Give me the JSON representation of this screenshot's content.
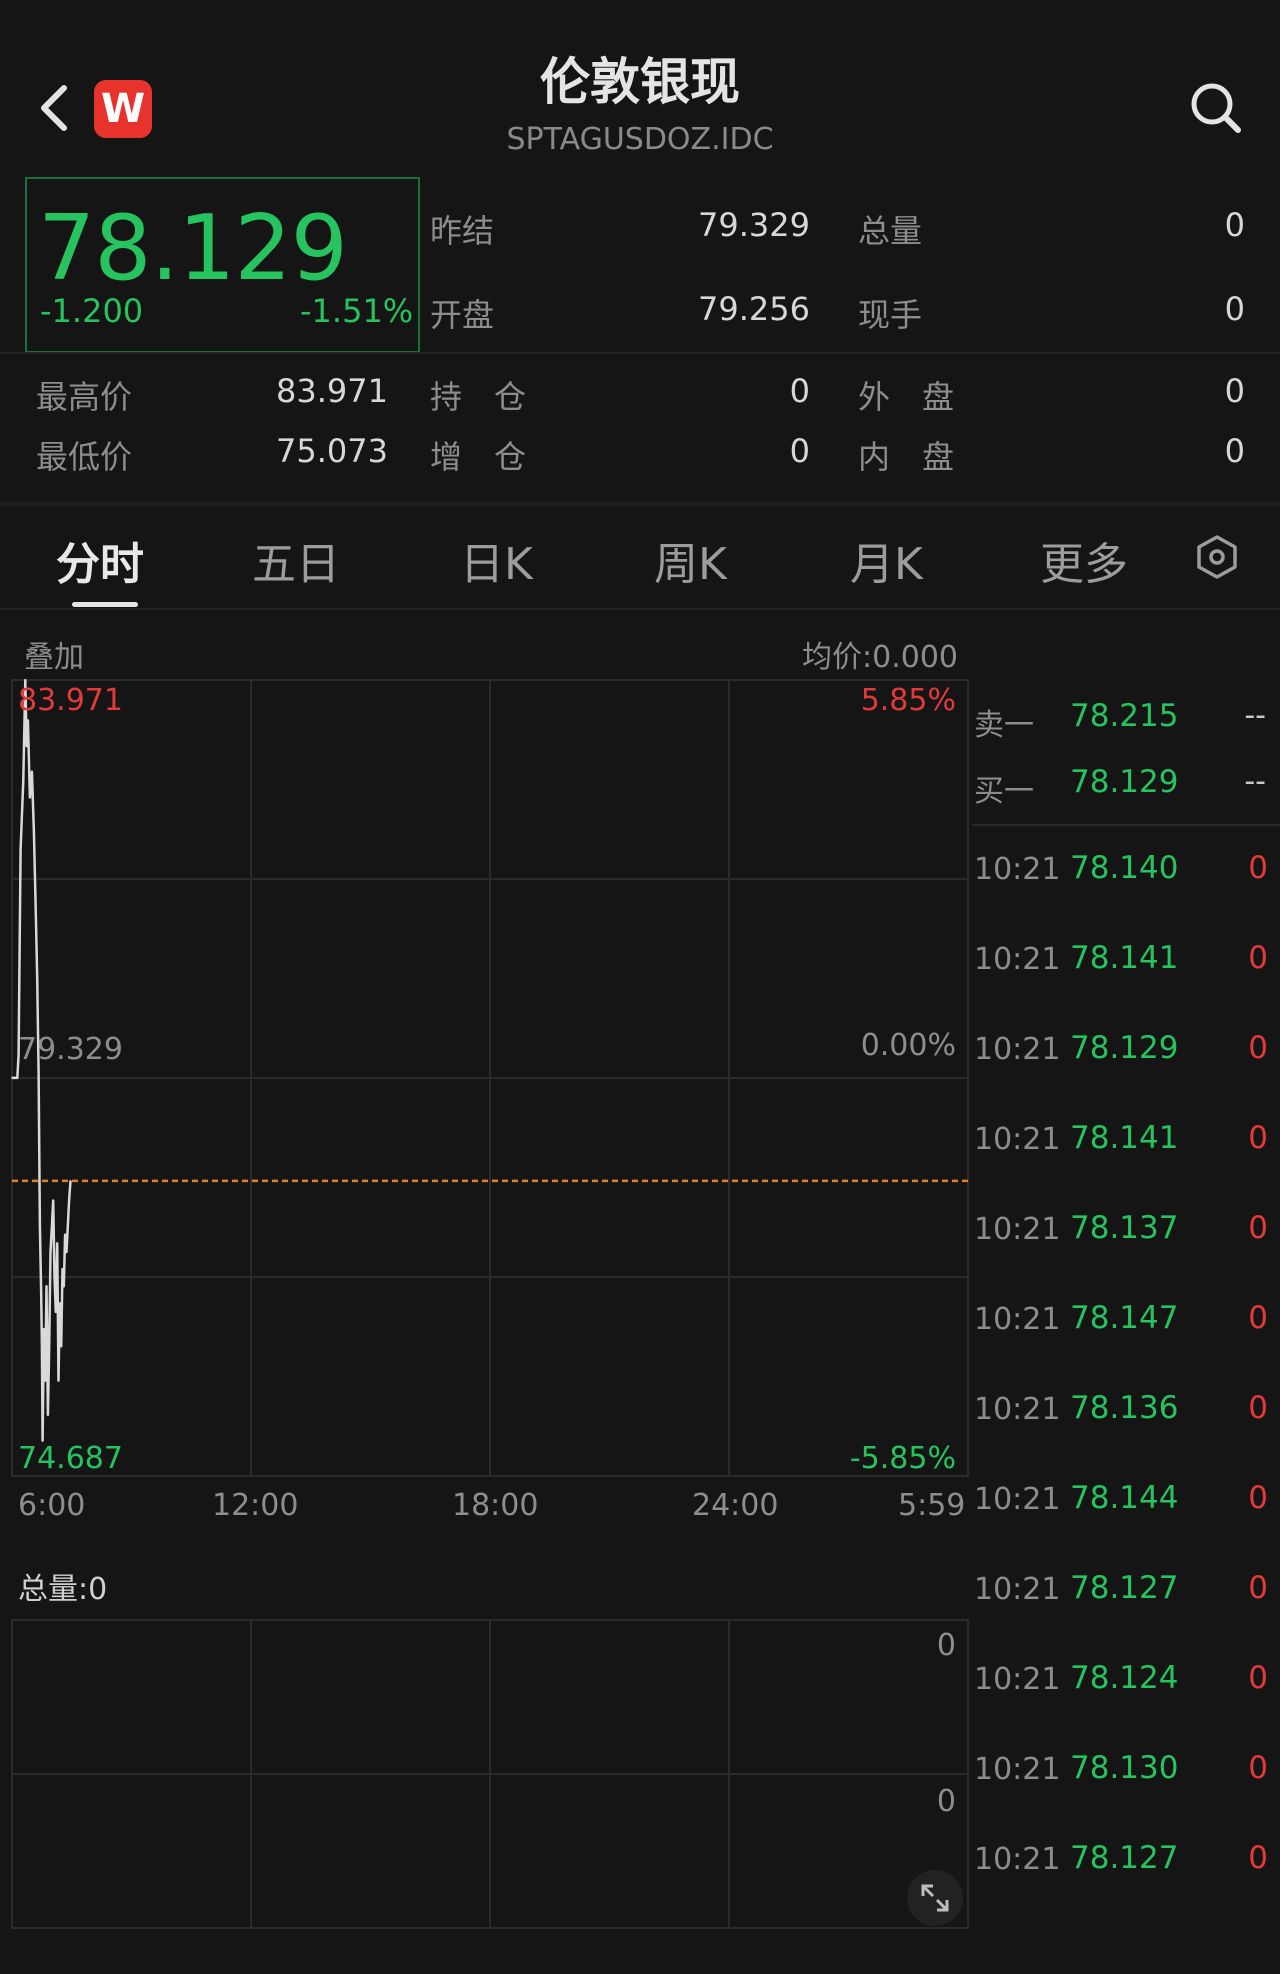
{
  "header": {
    "title": "伦敦银现",
    "code": "SPTAGUSDOZ.IDC",
    "logo_letter": "W"
  },
  "quote": {
    "price": "78.129",
    "change": "-1.200",
    "change_pct": "-1.51%"
  },
  "stats": {
    "prev_settle_label": "昨结",
    "prev_settle": "79.329",
    "total_vol_label": "总量",
    "total_vol": "0",
    "open_label": "开盘",
    "open": "79.256",
    "cur_hand_label": "现手",
    "cur_hand": "0",
    "high_label": "最高价",
    "high": "83.971",
    "pos_label": "持　仓",
    "pos": "0",
    "outer_label": "外　盘",
    "outer": "0",
    "low_label": "最低价",
    "low": "75.073",
    "pos_add_label": "增　仓",
    "pos_add": "0",
    "inner_label": "内　盘",
    "inner": "0"
  },
  "tabs": [
    "分时",
    "五日",
    "日K",
    "周K",
    "月K",
    "更多"
  ],
  "chart": {
    "overlay_label": "叠加",
    "avg_price": "均价:0.000",
    "y_top": "83.971",
    "y_mid": "79.329",
    "y_bottom": "74.687",
    "pct_top": "5.85%",
    "pct_mid": "0.00%",
    "pct_bottom": "-5.85%",
    "x_labels": [
      "6:00",
      "12:00",
      "18:00",
      "24:00",
      "5:59"
    ],
    "volume_label": "总量:0",
    "vol_axis_top": "0",
    "vol_axis_mid": "0",
    "colors": {
      "line": "#d9d9d9",
      "avg_line": "#e0812b",
      "up": "#e23a3a",
      "down": "#27c35f"
    }
  },
  "chart_data": {
    "type": "line",
    "title": "",
    "xlabel": "",
    "ylabel": "",
    "x_ticks": [
      "6:00",
      "12:00",
      "18:00",
      "24:00",
      "5:59"
    ],
    "ylim": [
      74.687,
      83.971
    ],
    "reference_price": 79.329,
    "current_price_line": 78.129,
    "grid": true,
    "series": [
      {
        "name": "",
        "x_minutes_from_start": [
          0,
          7,
          8,
          10,
          13,
          17,
          20,
          22,
          24,
          27,
          30,
          33,
          36,
          38,
          40,
          42,
          44,
          45,
          46,
          48,
          50,
          52,
          54,
          56,
          58,
          60,
          62,
          64,
          66,
          68,
          70,
          72,
          74,
          76,
          78,
          80,
          82,
          84,
          86,
          88
        ],
        "values": [
          79.33,
          79.33,
          79.33,
          79.6,
          82.0,
          82.8,
          83.97,
          83.2,
          83.5,
          82.6,
          82.9,
          82.2,
          81.2,
          80.5,
          79.4,
          77.6,
          76.8,
          76.2,
          75.1,
          76.4,
          75.8,
          76.9,
          75.4,
          76.2,
          77.3,
          77.6,
          77.9,
          77.0,
          76.6,
          77.4,
          75.8,
          76.7,
          76.2,
          77.1,
          76.9,
          77.5,
          77.3,
          77.6,
          77.9,
          78.13
        ]
      }
    ]
  },
  "orderbook": [
    {
      "label": "卖一",
      "price": "78.215",
      "vol": "--"
    },
    {
      "label": "买一",
      "price": "78.129",
      "vol": "--"
    }
  ],
  "trades": [
    {
      "time": "10:21",
      "price": "78.140",
      "vol": "0"
    },
    {
      "time": "10:21",
      "price": "78.141",
      "vol": "0"
    },
    {
      "time": "10:21",
      "price": "78.129",
      "vol": "0"
    },
    {
      "time": "10:21",
      "price": "78.141",
      "vol": "0"
    },
    {
      "time": "10:21",
      "price": "78.137",
      "vol": "0"
    },
    {
      "time": "10:21",
      "price": "78.147",
      "vol": "0"
    },
    {
      "time": "10:21",
      "price": "78.136",
      "vol": "0"
    },
    {
      "time": "10:21",
      "price": "78.144",
      "vol": "0"
    },
    {
      "time": "10:21",
      "price": "78.127",
      "vol": "0"
    },
    {
      "time": "10:21",
      "price": "78.124",
      "vol": "0"
    },
    {
      "time": "10:21",
      "price": "78.130",
      "vol": "0"
    },
    {
      "time": "10:21",
      "price": "78.127",
      "vol": "0"
    }
  ]
}
